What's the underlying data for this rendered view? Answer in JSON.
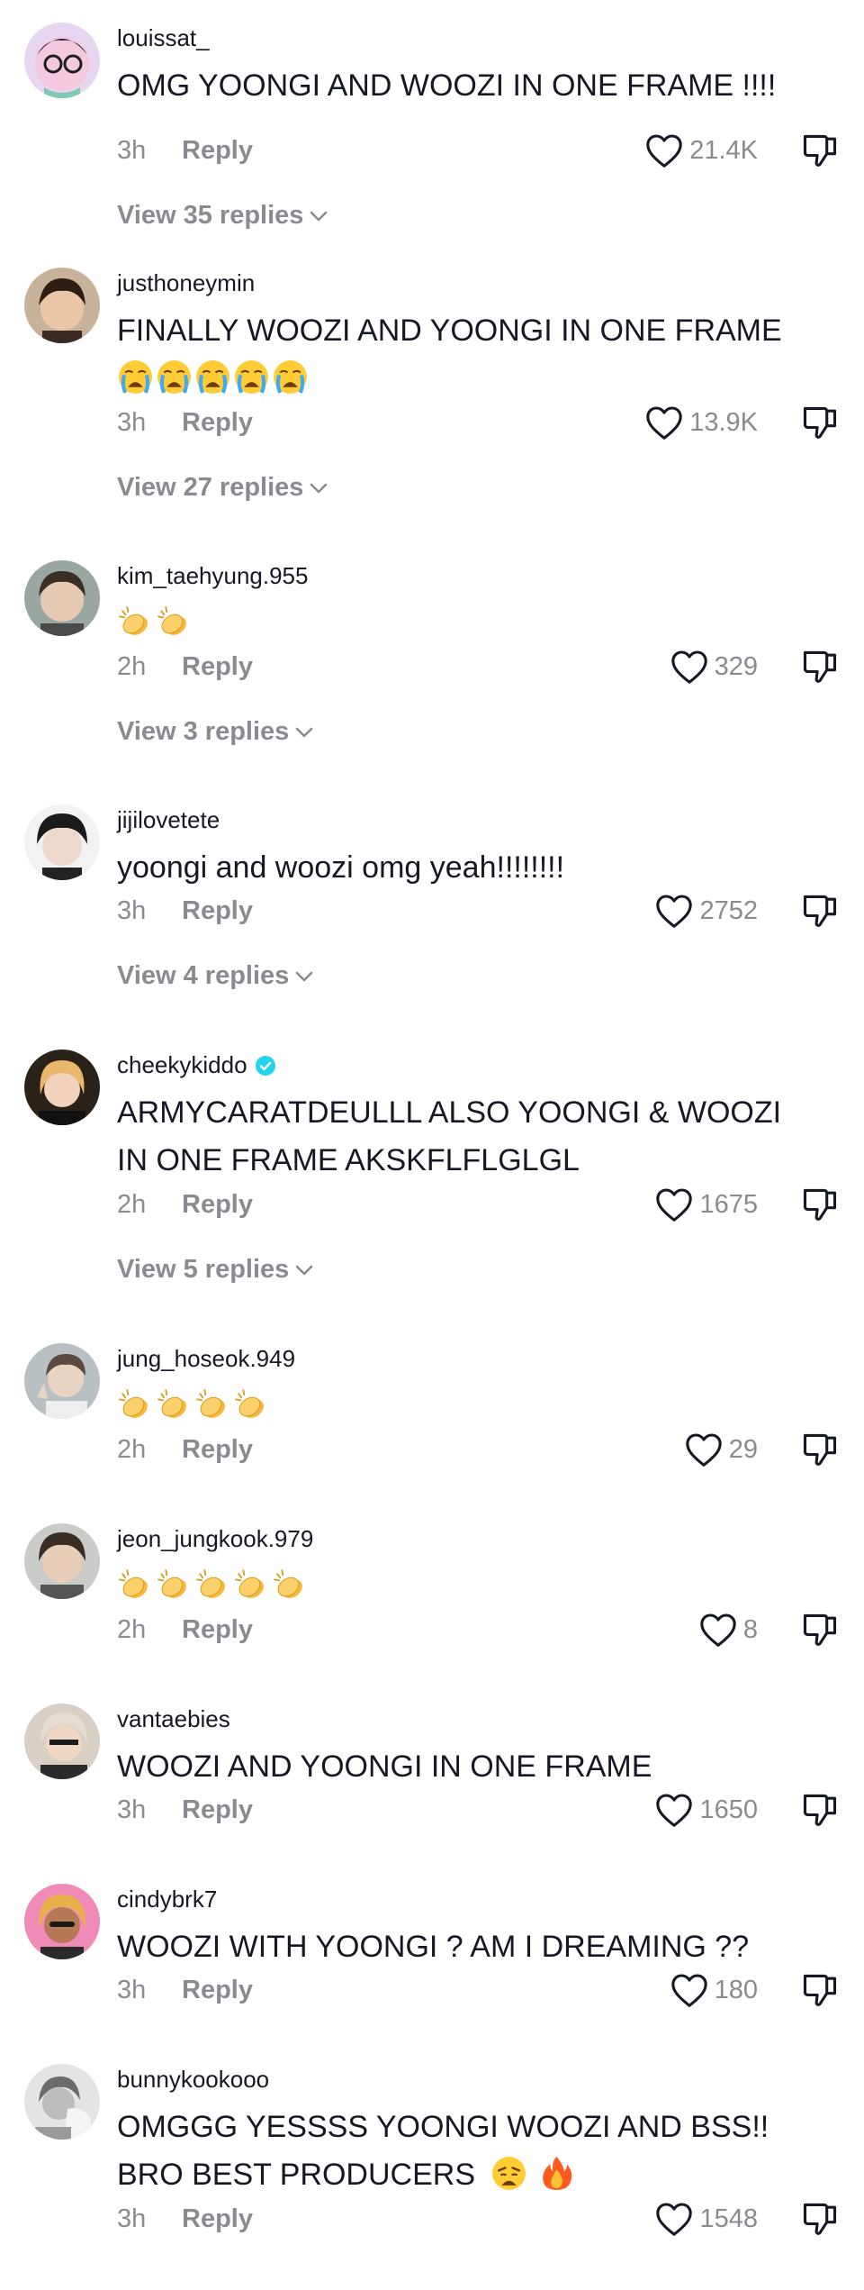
{
  "comments": [
    {
      "username": "louissat_",
      "text": "OMG YOONGI AND WOOZI IN ONE FRAME !!!!",
      "time": "3h",
      "reply": "Reply",
      "likes": "21.4K",
      "view_replies": "View 35 replies",
      "emoji_count": 0,
      "emoji_kind": "",
      "verified": false
    },
    {
      "username": "justhoneymin",
      "text": "FINALLY WOOZI AND YOONGI IN ONE FRAME",
      "time": "3h",
      "reply": "Reply",
      "likes": "13.9K",
      "view_replies": "View 27 replies",
      "emoji_count": 5,
      "emoji_kind": "crying-face",
      "verified": false
    },
    {
      "username": "kim_taehyung.955",
      "text": "",
      "time": "2h",
      "reply": "Reply",
      "likes": "329",
      "view_replies": "View 3 replies",
      "emoji_count": 2,
      "emoji_kind": "clapping-hands",
      "verified": false
    },
    {
      "username": "jijilovetete",
      "text": "yoongi and woozi omg yeah!!!!!!!!",
      "time": "3h",
      "reply": "Reply",
      "likes": "2752",
      "view_replies": "View 4 replies",
      "emoji_count": 0,
      "emoji_kind": "",
      "verified": false
    },
    {
      "username": "cheekykiddo",
      "text": "ARMYCARATDEULLL ALSO YOONGI & WOOZI IN ONE FRAME AKSKFLFLGLGL",
      "time": "2h",
      "reply": "Reply",
      "likes": "1675",
      "view_replies": "View 5 replies",
      "emoji_count": 0,
      "emoji_kind": "",
      "verified": true
    },
    {
      "username": "jung_hoseok.949",
      "text": "",
      "time": "2h",
      "reply": "Reply",
      "likes": "29",
      "view_replies": "",
      "emoji_count": 4,
      "emoji_kind": "clapping-hands",
      "verified": false
    },
    {
      "username": "jeon_jungkook.979",
      "text": "",
      "time": "2h",
      "reply": "Reply",
      "likes": "8",
      "view_replies": "",
      "emoji_count": 5,
      "emoji_kind": "clapping-hands",
      "verified": false
    },
    {
      "username": "vantaebies",
      "text": "WOOZI AND YOONGI IN ONE FRAME",
      "time": "3h",
      "reply": "Reply",
      "likes": "1650",
      "view_replies": "",
      "emoji_count": 0,
      "emoji_kind": "",
      "verified": false
    },
    {
      "username": "cindybrk7",
      "text": "WOOZI WITH YOONGI ? AM I DREAMING ??",
      "time": "3h",
      "reply": "Reply",
      "likes": "180",
      "view_replies": "",
      "emoji_count": 0,
      "emoji_kind": "",
      "verified": false
    },
    {
      "username": "bunnykookooo",
      "text": "OMGGG YESSSS YOONGI WOOZI AND BSS!! BRO BEST PRODUCERS",
      "time": "3h",
      "reply": "Reply",
      "likes": "1548",
      "view_replies": "",
      "emoji_count": 2,
      "emoji_kind": "weary-face,fire",
      "verified": false
    }
  ],
  "colors": {
    "text": "#161823",
    "secondary": "#8a8b91",
    "verified": "#20d5ec"
  }
}
